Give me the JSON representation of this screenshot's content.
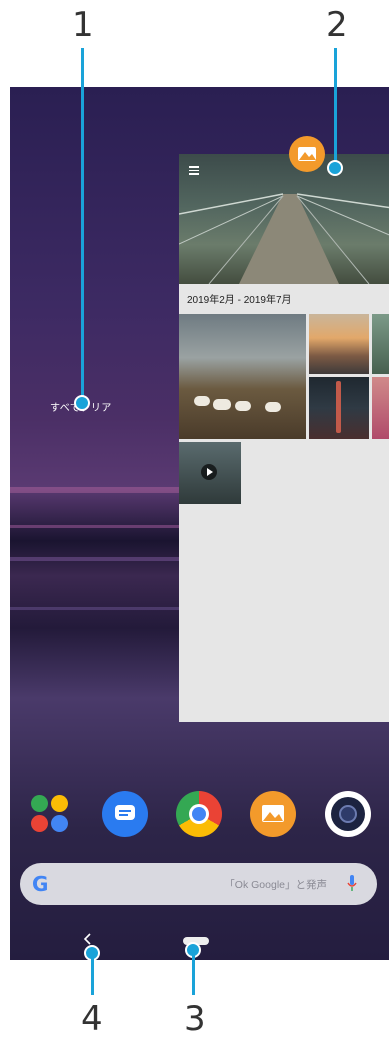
{
  "callouts": {
    "c1": "1",
    "c2": "2",
    "c3": "3",
    "c4": "4"
  },
  "recents": {
    "clear_all_label": "すべてクリア",
    "card": {
      "app_icon": "photos-icon",
      "date_range": "2019年2月 - 2019年7月"
    }
  },
  "dock": {
    "apps": [
      "google-apps-folder-icon",
      "messages-icon",
      "chrome-icon",
      "photos-icon",
      "camera-icon"
    ]
  },
  "search": {
    "logo": "G",
    "hint": "「Ok Google」と発声"
  },
  "navigation": {
    "back_icon": "back-chevron-icon",
    "home_icon": "home-pill-icon"
  },
  "colors": {
    "callout": "#1aa3d9",
    "photos_orange": "#f39a2b",
    "messages_blue": "#2a7bf0"
  }
}
